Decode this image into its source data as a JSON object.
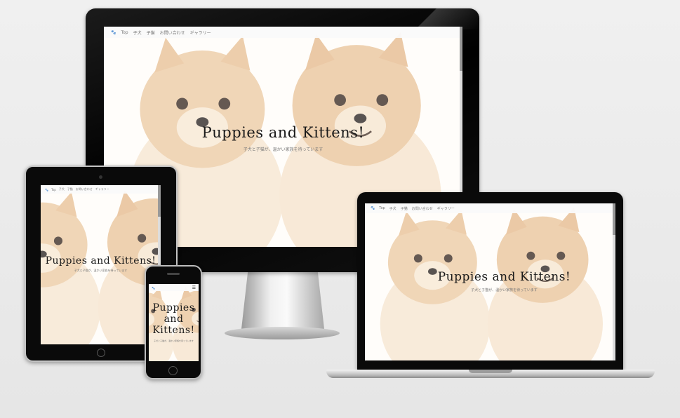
{
  "site": {
    "title": "Puppies and Kittens!",
    "title_mobile": [
      "Puppies",
      "and",
      "Kittens!"
    ],
    "tagline": "子犬と子猫が、温かい家族を待っています",
    "nav_icon": "paw-icon",
    "nav_items": [
      "Top",
      "子犬",
      "子猫",
      "お問い合わせ",
      "ギャラリー"
    ],
    "menu_icon": "hamburger-icon"
  },
  "devices": [
    "desktop-monitor",
    "tablet",
    "phone",
    "laptop"
  ],
  "colors": {
    "background": "#ececec",
    "bezel": "#0a0a0a",
    "fur": "#e9c49a",
    "title_text": "#1a1a1a"
  }
}
